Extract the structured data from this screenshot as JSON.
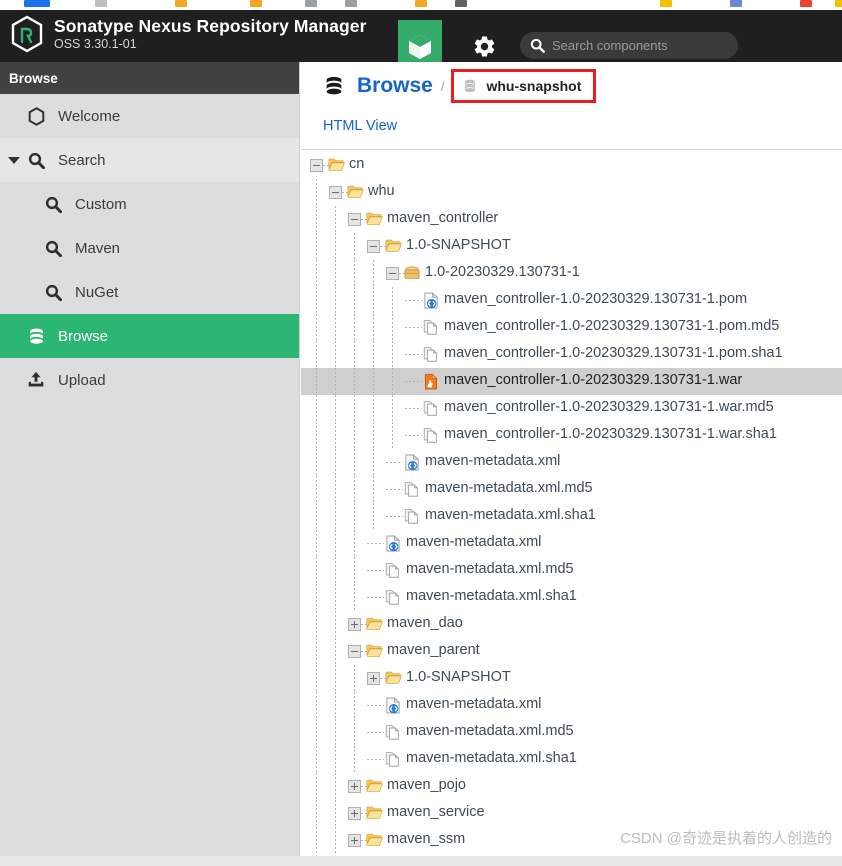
{
  "browser_bookmark_colors": [
    "#1a73e8",
    "#bdbdbd",
    "#f5a623",
    "#f5a623",
    "#9aa0a6",
    "#9aa0a6",
    "#f5a623",
    "#5f6368",
    "#f2c200",
    "#6e85d6",
    "#ea4335",
    "#f2c200",
    "#5f6368"
  ],
  "header": {
    "brand_title": "Sonatype Nexus Repository Manager",
    "brand_subtitle": "OSS 3.30.1-01",
    "logo_icon": "nexus-cube-icon",
    "box_icon": "cube-icon",
    "gear_icon": "gear-icon",
    "search": {
      "icon": "search-icon",
      "placeholder": "Search components",
      "value": ""
    },
    "accent_green": "#35ab6a",
    "background": "#1f1f1f"
  },
  "sidebar": {
    "header_label": "Browse",
    "items": [
      {
        "label": "Welcome",
        "icon": "hexagon-icon",
        "type": "item",
        "selected": false
      },
      {
        "label": "Search",
        "icon": "search-icon",
        "type": "group",
        "selected": false,
        "expanded": true
      },
      {
        "label": "Custom",
        "icon": "search-icon",
        "type": "child",
        "selected": false
      },
      {
        "label": "Maven",
        "icon": "search-icon",
        "type": "child",
        "selected": false
      },
      {
        "label": "NuGet",
        "icon": "search-icon",
        "type": "child",
        "selected": false
      },
      {
        "label": "Browse",
        "icon": "database-icon",
        "type": "item",
        "selected": true
      },
      {
        "label": "Upload",
        "icon": "upload-icon",
        "type": "item",
        "selected": false
      }
    ],
    "selected_color": "#2bb673",
    "background": "#dddddd"
  },
  "content": {
    "breadcrumb": {
      "db_icon": "database-icon",
      "root_label": "Browse",
      "separator": "/",
      "repo_icon": "repository-icon",
      "repo_label": "whu-snapshot",
      "highlight_color": "#ee1c1c"
    },
    "html_view_link": "HTML View",
    "tree": [
      {
        "label": "cn",
        "depth": 0,
        "icon": "folder-open-icon",
        "knob": "minus"
      },
      {
        "label": "whu",
        "depth": 1,
        "icon": "folder-open-icon",
        "knob": "minus"
      },
      {
        "label": "maven_controller",
        "depth": 2,
        "icon": "folder-open-icon",
        "knob": "minus"
      },
      {
        "label": "1.0-SNAPSHOT",
        "depth": 3,
        "icon": "folder-open-icon",
        "knob": "minus"
      },
      {
        "label": "1.0-20230329.130731-1",
        "depth": 4,
        "icon": "package-icon",
        "knob": "minus"
      },
      {
        "label": "maven_controller-1.0-20230329.130731-1.pom",
        "depth": 5,
        "icon": "xml-file-icon",
        "knob": "none"
      },
      {
        "label": "maven_controller-1.0-20230329.130731-1.pom.md5",
        "depth": 5,
        "icon": "generic-file-icon",
        "knob": "none"
      },
      {
        "label": "maven_controller-1.0-20230329.130731-1.pom.sha1",
        "depth": 5,
        "icon": "generic-file-icon",
        "knob": "none"
      },
      {
        "label": "maven_controller-1.0-20230329.130731-1.war",
        "depth": 5,
        "icon": "war-file-icon",
        "knob": "none",
        "highlight": true
      },
      {
        "label": "maven_controller-1.0-20230329.130731-1.war.md5",
        "depth": 5,
        "icon": "generic-file-icon",
        "knob": "none"
      },
      {
        "label": "maven_controller-1.0-20230329.130731-1.war.sha1",
        "depth": 5,
        "icon": "generic-file-icon",
        "knob": "none"
      },
      {
        "label": "maven-metadata.xml",
        "depth": 4,
        "icon": "xml-file-icon",
        "knob": "none"
      },
      {
        "label": "maven-metadata.xml.md5",
        "depth": 4,
        "icon": "generic-file-icon",
        "knob": "none"
      },
      {
        "label": "maven-metadata.xml.sha1",
        "depth": 4,
        "icon": "generic-file-icon",
        "knob": "none"
      },
      {
        "label": "maven-metadata.xml",
        "depth": 3,
        "icon": "xml-file-icon",
        "knob": "none"
      },
      {
        "label": "maven-metadata.xml.md5",
        "depth": 3,
        "icon": "generic-file-icon",
        "knob": "none"
      },
      {
        "label": "maven-metadata.xml.sha1",
        "depth": 3,
        "icon": "generic-file-icon",
        "knob": "none"
      },
      {
        "label": "maven_dao",
        "depth": 2,
        "icon": "folder-open-icon",
        "knob": "plus"
      },
      {
        "label": "maven_parent",
        "depth": 2,
        "icon": "folder-open-icon",
        "knob": "minus"
      },
      {
        "label": "1.0-SNAPSHOT",
        "depth": 3,
        "icon": "folder-open-icon",
        "knob": "plus"
      },
      {
        "label": "maven-metadata.xml",
        "depth": 3,
        "icon": "xml-file-icon",
        "knob": "none"
      },
      {
        "label": "maven-metadata.xml.md5",
        "depth": 3,
        "icon": "generic-file-icon",
        "knob": "none"
      },
      {
        "label": "maven-metadata.xml.sha1",
        "depth": 3,
        "icon": "generic-file-icon",
        "knob": "none"
      },
      {
        "label": "maven_pojo",
        "depth": 2,
        "icon": "folder-open-icon",
        "knob": "plus"
      },
      {
        "label": "maven_service",
        "depth": 2,
        "icon": "folder-open-icon",
        "knob": "plus"
      },
      {
        "label": "maven_ssm",
        "depth": 2,
        "icon": "folder-open-icon",
        "knob": "plus"
      }
    ],
    "watermark": "CSDN @奇迹是执着的人创造的"
  }
}
